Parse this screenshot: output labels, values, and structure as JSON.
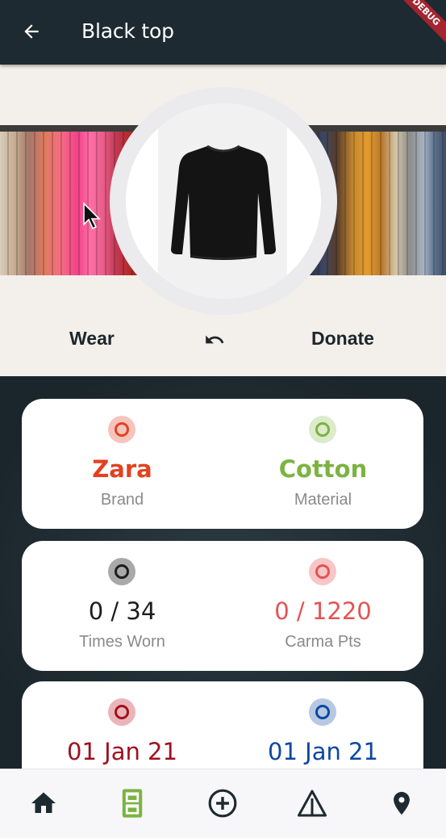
{
  "appbar": {
    "title": "Black top",
    "back_icon": "arrow-left-icon",
    "debug_banner": "DEBUG"
  },
  "hero": {
    "item_image": "black-sweater-photo",
    "background_image": "clothes-rack-photo",
    "actions": {
      "wear_label": "Wear",
      "undo_icon": "undo-icon",
      "donate_label": "Donate"
    }
  },
  "cards": [
    {
      "left": {
        "value": "Zara",
        "label": "Brand",
        "color": "#e2421f",
        "icon_bg": "#f6c4bd",
        "icon_ring": "#e2421f"
      },
      "right": {
        "value": "Cotton",
        "label": "Material",
        "color": "#7cb342",
        "icon_bg": "#dcebcb",
        "icon_ring": "#7cb342"
      }
    },
    {
      "left": {
        "value": "0 / 34",
        "label": "Times Worn",
        "color": "#1d1d1d",
        "icon_bg": "#a9a9a9",
        "icon_ring": "#1d1d1d"
      },
      "right": {
        "value": "0 / 1220",
        "label": "Carma Pts",
        "color": "#e45353",
        "icon_bg": "#f8c6c6",
        "icon_ring": "#e45353"
      }
    },
    {
      "left": {
        "value": "01 Jan 21",
        "label": "",
        "color": "#a0111f",
        "icon_bg": "#eab5b9",
        "icon_ring": "#a0111f"
      },
      "right": {
        "value": "01 Jan 21",
        "label": "",
        "color": "#0d47a1",
        "icon_bg": "#b7c8e3",
        "icon_ring": "#0d47a1"
      }
    }
  ],
  "bottom_nav": {
    "items": [
      {
        "icon": "home-icon",
        "color": "#1e2a31"
      },
      {
        "icon": "wardrobe-icon",
        "color": "#7cb342",
        "active": true
      },
      {
        "icon": "add-circle-icon",
        "color": "#1e2a31"
      },
      {
        "icon": "warning-icon",
        "color": "#1e2a31"
      },
      {
        "icon": "location-pin-icon",
        "color": "#1e2a31"
      }
    ]
  },
  "colors": {
    "appbar_bg": "#1e2a31",
    "hero_bg": "#f3efea",
    "content_bg": "#1f2b32",
    "card_bg": "#ffffff"
  }
}
